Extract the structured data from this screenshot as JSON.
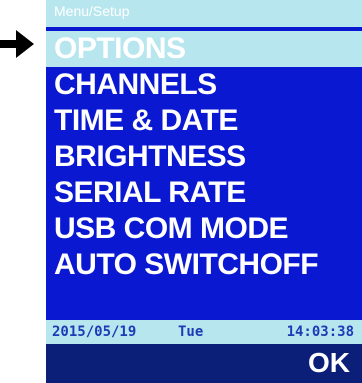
{
  "header": {
    "title": "Menu/Setup"
  },
  "menu": {
    "items": [
      {
        "label": "OPTIONS",
        "selected": true
      },
      {
        "label": "CHANNELS",
        "selected": false
      },
      {
        "label": "TIME & DATE",
        "selected": false
      },
      {
        "label": "BRIGHTNESS",
        "selected": false
      },
      {
        "label": "SERIAL RATE",
        "selected": false
      },
      {
        "label": "USB COM MODE",
        "selected": false
      },
      {
        "label": "AUTO SWITCHOFF",
        "selected": false
      }
    ]
  },
  "status": {
    "date": "2015/05/19",
    "day": "Tue",
    "time": "14:03:38"
  },
  "softkey": {
    "ok_label": "OK"
  },
  "icons": {
    "pointer": "right-arrow-pointer-icon"
  },
  "colors": {
    "screen_background": "#0a18d2",
    "highlight": "#b7e6ef",
    "status_text": "#1c3bb5",
    "softkey_bar": "#0b1f79",
    "text": "#ffffff"
  }
}
